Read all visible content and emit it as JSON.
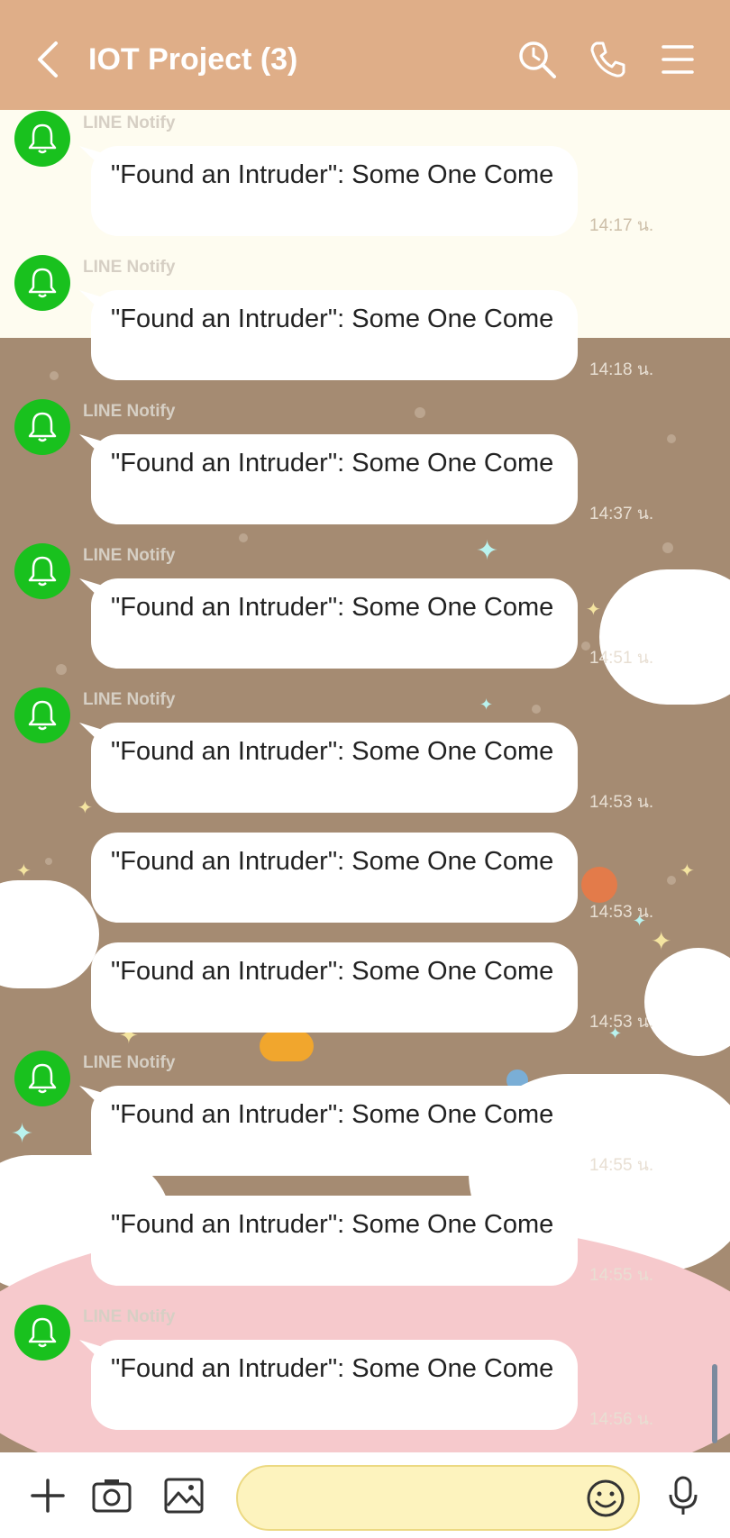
{
  "header": {
    "title": "IOT Project (3)",
    "icons": [
      "back-icon",
      "search-icon",
      "phone-icon",
      "menu-icon"
    ]
  },
  "messages": [
    {
      "sender": "LINE Notify",
      "text": "\"Found an Intruder\": Some One Come",
      "time": "14:17 น."
    },
    {
      "sender": "LINE Notify",
      "text": "\"Found an Intruder\": Some One Come",
      "time": "14:18 น."
    },
    {
      "sender": "LINE Notify",
      "text": "\"Found an Intruder\": Some One Come",
      "time": "14:37 น."
    },
    {
      "sender": "LINE Notify",
      "text": "\"Found an Intruder\": Some One Come",
      "time": "14:51 น."
    },
    {
      "sender": "LINE Notify",
      "text": "\"Found an Intruder\": Some One Come",
      "time": "14:53 น."
    },
    {
      "sender": "",
      "text": "\"Found an Intruder\": Some One Come",
      "time": "14:53 น."
    },
    {
      "sender": "",
      "text": "\"Found an Intruder\": Some One Come",
      "time": "14:53 น."
    },
    {
      "sender": "LINE Notify",
      "text": "\"Found an Intruder\": Some One Come",
      "time": "14:55 น."
    },
    {
      "sender": "",
      "text": "\"Found an Intruder\": Some One Come",
      "time": "14:55 น."
    },
    {
      "sender": "LINE Notify",
      "text": "\"Found an Intruder\": Some One Come",
      "time": "14:56 น."
    }
  ],
  "footer": {
    "icons": [
      "plus-icon",
      "camera-icon",
      "image-icon",
      "emoji-icon",
      "microphone-icon"
    ],
    "input_value": ""
  },
  "colors": {
    "header_bg": "#dfae88",
    "avatar_green": "#19c11e",
    "chat_bg_brown": "#a58b72",
    "chat_bg_cream": "#fefcf0",
    "input_bg": "#fdf3be"
  }
}
